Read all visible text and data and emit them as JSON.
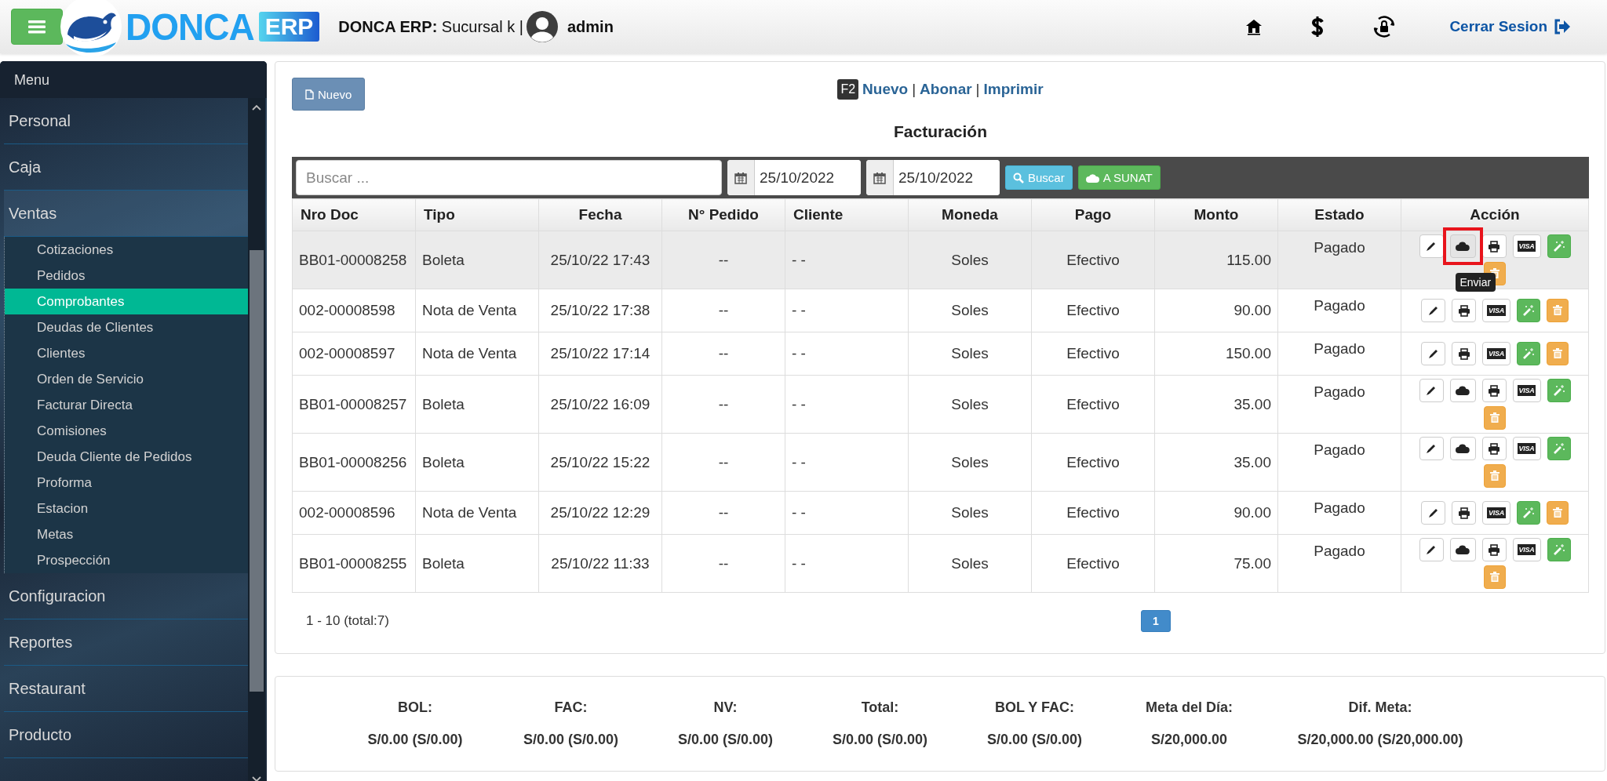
{
  "header": {
    "logo_name": "DONCA",
    "logo_badge": "ERP",
    "branch": "**DONCA ERP:** Sucursal k |",
    "user": "admin",
    "logout": "Cerrar Sesion"
  },
  "sidebar": {
    "title": "Menu",
    "items": [
      {
        "label": "Personal",
        "expanded": false
      },
      {
        "label": "Caja",
        "expanded": false
      },
      {
        "label": "Ventas",
        "expanded": true,
        "children": [
          {
            "label": "Cotizaciones",
            "selected": false
          },
          {
            "label": "Pedidos",
            "selected": false
          },
          {
            "label": "Comprobantes",
            "selected": true
          },
          {
            "label": "Deudas de Clientes",
            "selected": false
          },
          {
            "label": "Clientes",
            "selected": false
          },
          {
            "label": "Orden de Servicio",
            "selected": false
          },
          {
            "label": "Facturar Directa",
            "selected": false
          },
          {
            "label": "Comisiones",
            "selected": false
          },
          {
            "label": "Deuda Cliente de Pedidos",
            "selected": false
          },
          {
            "label": "Proforma",
            "selected": false
          },
          {
            "label": "Estacion",
            "selected": false
          },
          {
            "label": "Metas",
            "selected": false
          },
          {
            "label": "Prospección",
            "selected": false
          }
        ]
      },
      {
        "label": "Configuracion",
        "expanded": false
      },
      {
        "label": "Reportes",
        "expanded": false
      },
      {
        "label": "Restaurant",
        "expanded": false
      },
      {
        "label": "Producto",
        "expanded": false
      }
    ]
  },
  "toolbar": {
    "new_button": "Nuevo",
    "shortcut_key": "F2",
    "shortcut_links": [
      "Nuevo",
      "Abonar",
      "Imprimir"
    ],
    "separator": "|",
    "title": "Facturación"
  },
  "filters": {
    "search": {
      "placeholder": "Buscar ..."
    },
    "date_from": "25/10/2022",
    "date_to": "25/10/2022",
    "search_button": "Buscar",
    "sunat_button": "A SUNAT"
  },
  "table": {
    "columns": [
      "Nro Doc",
      "Tipo",
      "Fecha",
      "N° Pedido",
      "Cliente",
      "Moneda",
      "Pago",
      "Monto",
      "Estado",
      "Acción"
    ],
    "rows": [
      {
        "hovered": true,
        "cells": [
          "BB01-00008258",
          "Boleta",
          "25/10/22 17:43",
          "--",
          "- -",
          "Soles",
          "Efectivo",
          "115.00",
          "Pagado"
        ],
        "actions": [
          {
            "kind": "edit",
            "highlighted": false
          },
          {
            "kind": "send",
            "highlighted": true,
            "tooltip": "Enviar"
          },
          {
            "kind": "print",
            "highlighted": false
          },
          {
            "kind": "card",
            "label": "VISA",
            "highlighted": false
          },
          {
            "kind": "magic",
            "highlighted": false
          },
          {
            "kind": "delete",
            "highlighted": false
          }
        ]
      },
      {
        "hovered": false,
        "cells": [
          "002-00008598",
          "Nota de Venta",
          "25/10/22 17:38",
          "--",
          "- -",
          "Soles",
          "Efectivo",
          "90.00",
          "Pagado"
        ],
        "actions": [
          {
            "kind": "edit",
            "highlighted": false
          },
          {
            "kind": "print",
            "highlighted": false
          },
          {
            "kind": "card",
            "label": "VISA",
            "highlighted": false
          },
          {
            "kind": "magic",
            "highlighted": false
          },
          {
            "kind": "delete",
            "highlighted": false
          }
        ]
      },
      {
        "hovered": false,
        "cells": [
          "002-00008597",
          "Nota de Venta",
          "25/10/22 17:14",
          "--",
          "- -",
          "Soles",
          "Efectivo",
          "150.00",
          "Pagado"
        ],
        "actions": [
          {
            "kind": "edit",
            "highlighted": false
          },
          {
            "kind": "print",
            "highlighted": false
          },
          {
            "kind": "card",
            "label": "VISA",
            "highlighted": false
          },
          {
            "kind": "magic",
            "highlighted": false
          },
          {
            "kind": "delete",
            "highlighted": false
          }
        ]
      },
      {
        "hovered": false,
        "cells": [
          "BB01-00008257",
          "Boleta",
          "25/10/22 16:09",
          "--",
          "- -",
          "Soles",
          "Efectivo",
          "35.00",
          "Pagado"
        ],
        "actions": [
          {
            "kind": "edit",
            "highlighted": false
          },
          {
            "kind": "send",
            "highlighted": false
          },
          {
            "kind": "print",
            "highlighted": false
          },
          {
            "kind": "card",
            "label": "VISA",
            "highlighted": false
          },
          {
            "kind": "magic",
            "highlighted": false
          },
          {
            "kind": "delete",
            "highlighted": false
          }
        ]
      },
      {
        "hovered": false,
        "cells": [
          "BB01-00008256",
          "Boleta",
          "25/10/22 15:22",
          "--",
          "- -",
          "Soles",
          "Efectivo",
          "35.00",
          "Pagado"
        ],
        "actions": [
          {
            "kind": "edit",
            "highlighted": false
          },
          {
            "kind": "send",
            "highlighted": false
          },
          {
            "kind": "print",
            "highlighted": false
          },
          {
            "kind": "card",
            "label": "VISA",
            "highlighted": false
          },
          {
            "kind": "magic",
            "highlighted": false
          },
          {
            "kind": "delete",
            "highlighted": false
          }
        ]
      },
      {
        "hovered": false,
        "cells": [
          "002-00008596",
          "Nota de Venta",
          "25/10/22 12:29",
          "--",
          "- -",
          "Soles",
          "Efectivo",
          "90.00",
          "Pagado"
        ],
        "actions": [
          {
            "kind": "edit",
            "highlighted": false
          },
          {
            "kind": "print",
            "highlighted": false
          },
          {
            "kind": "card",
            "label": "VISA",
            "highlighted": false
          },
          {
            "kind": "magic",
            "highlighted": false
          },
          {
            "kind": "delete",
            "highlighted": false
          }
        ]
      },
      {
        "hovered": false,
        "cells": [
          "BB01-00008255",
          "Boleta",
          "25/10/22 11:33",
          "--",
          "- -",
          "Soles",
          "Efectivo",
          "75.00",
          "Pagado"
        ],
        "actions": [
          {
            "kind": "edit",
            "highlighted": false
          },
          {
            "kind": "send",
            "highlighted": false
          },
          {
            "kind": "print",
            "highlighted": false
          },
          {
            "kind": "card",
            "label": "VISA",
            "highlighted": false
          },
          {
            "kind": "magic",
            "highlighted": false
          },
          {
            "kind": "delete",
            "highlighted": false
          }
        ]
      }
    ]
  },
  "pagination": {
    "summary": "1 - 10 (total:7)",
    "pages": [
      {
        "label": "1",
        "selected": true
      }
    ]
  },
  "summary": [
    {
      "label": "BOL:",
      "value": "S/0.00 (S/0.00)"
    },
    {
      "label": "FAC:",
      "value": "S/0.00 (S/0.00)"
    },
    {
      "label": "NV:",
      "value": "S/0.00 (S/0.00)"
    },
    {
      "label": "Total:",
      "value": "S/0.00 (S/0.00)"
    },
    {
      "label": "BOL Y FAC:",
      "value": "S/0.00 (S/0.00)"
    },
    {
      "label": "Meta del Día:",
      "value": "S/20,000.00"
    },
    {
      "label": "Dif. Meta:",
      "value": "S/20,000.00 (S/20,000.00)"
    }
  ]
}
